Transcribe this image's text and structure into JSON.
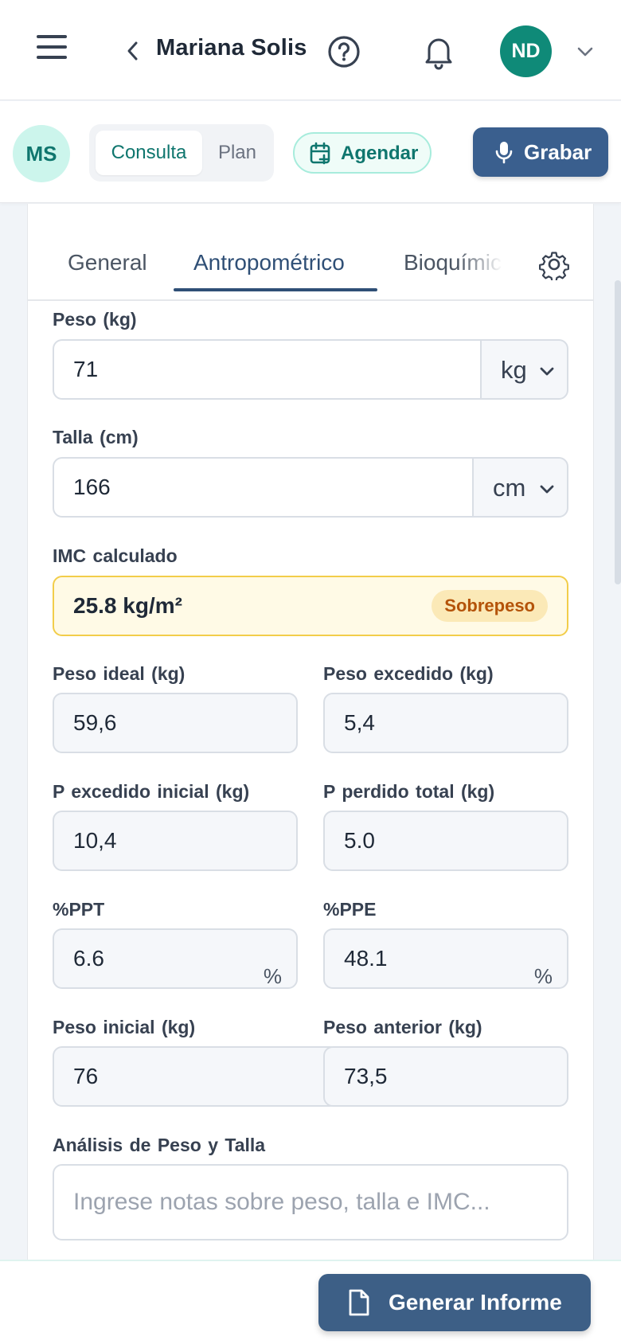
{
  "header": {
    "patient_name": "Mariana Solis",
    "user_initials": "ND",
    "icons": [
      "menu-icon",
      "chevron-left-icon",
      "help-circle-icon",
      "bell-icon",
      "chevron-down-icon"
    ]
  },
  "subbar": {
    "patient_initials": "MS",
    "segments": [
      {
        "label": "Consulta",
        "active": true
      },
      {
        "label": "Plan",
        "active": false
      }
    ],
    "agendar_label": "Agendar",
    "grabar_label": "Grabar"
  },
  "tabs": {
    "items": [
      {
        "label": "General",
        "active": false
      },
      {
        "label": "Antropométrico",
        "active": true
      },
      {
        "label": "Bioquímico",
        "active": false
      }
    ]
  },
  "form": {
    "peso": {
      "label": "Peso (kg)",
      "value": "71",
      "unit": "kg"
    },
    "talla": {
      "label": "Talla (cm)",
      "value": "166",
      "unit": "cm"
    },
    "imc": {
      "label": "IMC calculado",
      "value": "25.8 kg/m²",
      "badge": "Sobrepeso"
    },
    "peso_ideal": {
      "label": "Peso ideal (kg)",
      "value": "59,6"
    },
    "peso_excedido": {
      "label": "Peso excedido (kg)",
      "value": "5,4"
    },
    "p_excedido_inicial": {
      "label": "P excedido inicial (kg)",
      "value": "10,4"
    },
    "p_perdido_total": {
      "label": "P perdido total (kg)",
      "value": "5.0"
    },
    "ppt": {
      "label": "%PPT",
      "value": "6.6",
      "suffix": "%"
    },
    "ppe": {
      "label": "%PPE",
      "value": "48.1",
      "suffix": "%"
    },
    "peso_inicial": {
      "label": "Peso inicial (kg)",
      "value": "76"
    },
    "peso_anterior": {
      "label": "Peso anterior (kg)",
      "value": "73,5"
    },
    "analisis": {
      "label": "Análisis de Peso y Talla",
      "placeholder": "Ingrese notas sobre peso, talla e IMC..."
    }
  },
  "footer": {
    "generar_label": "Generar Informe"
  },
  "colors": {
    "primary": "#3a5f8e",
    "accent_teal": "#0f766e",
    "avatar_green": "#0f8a78",
    "warning_border": "#f2cd4a",
    "warning_text": "#b45309"
  }
}
